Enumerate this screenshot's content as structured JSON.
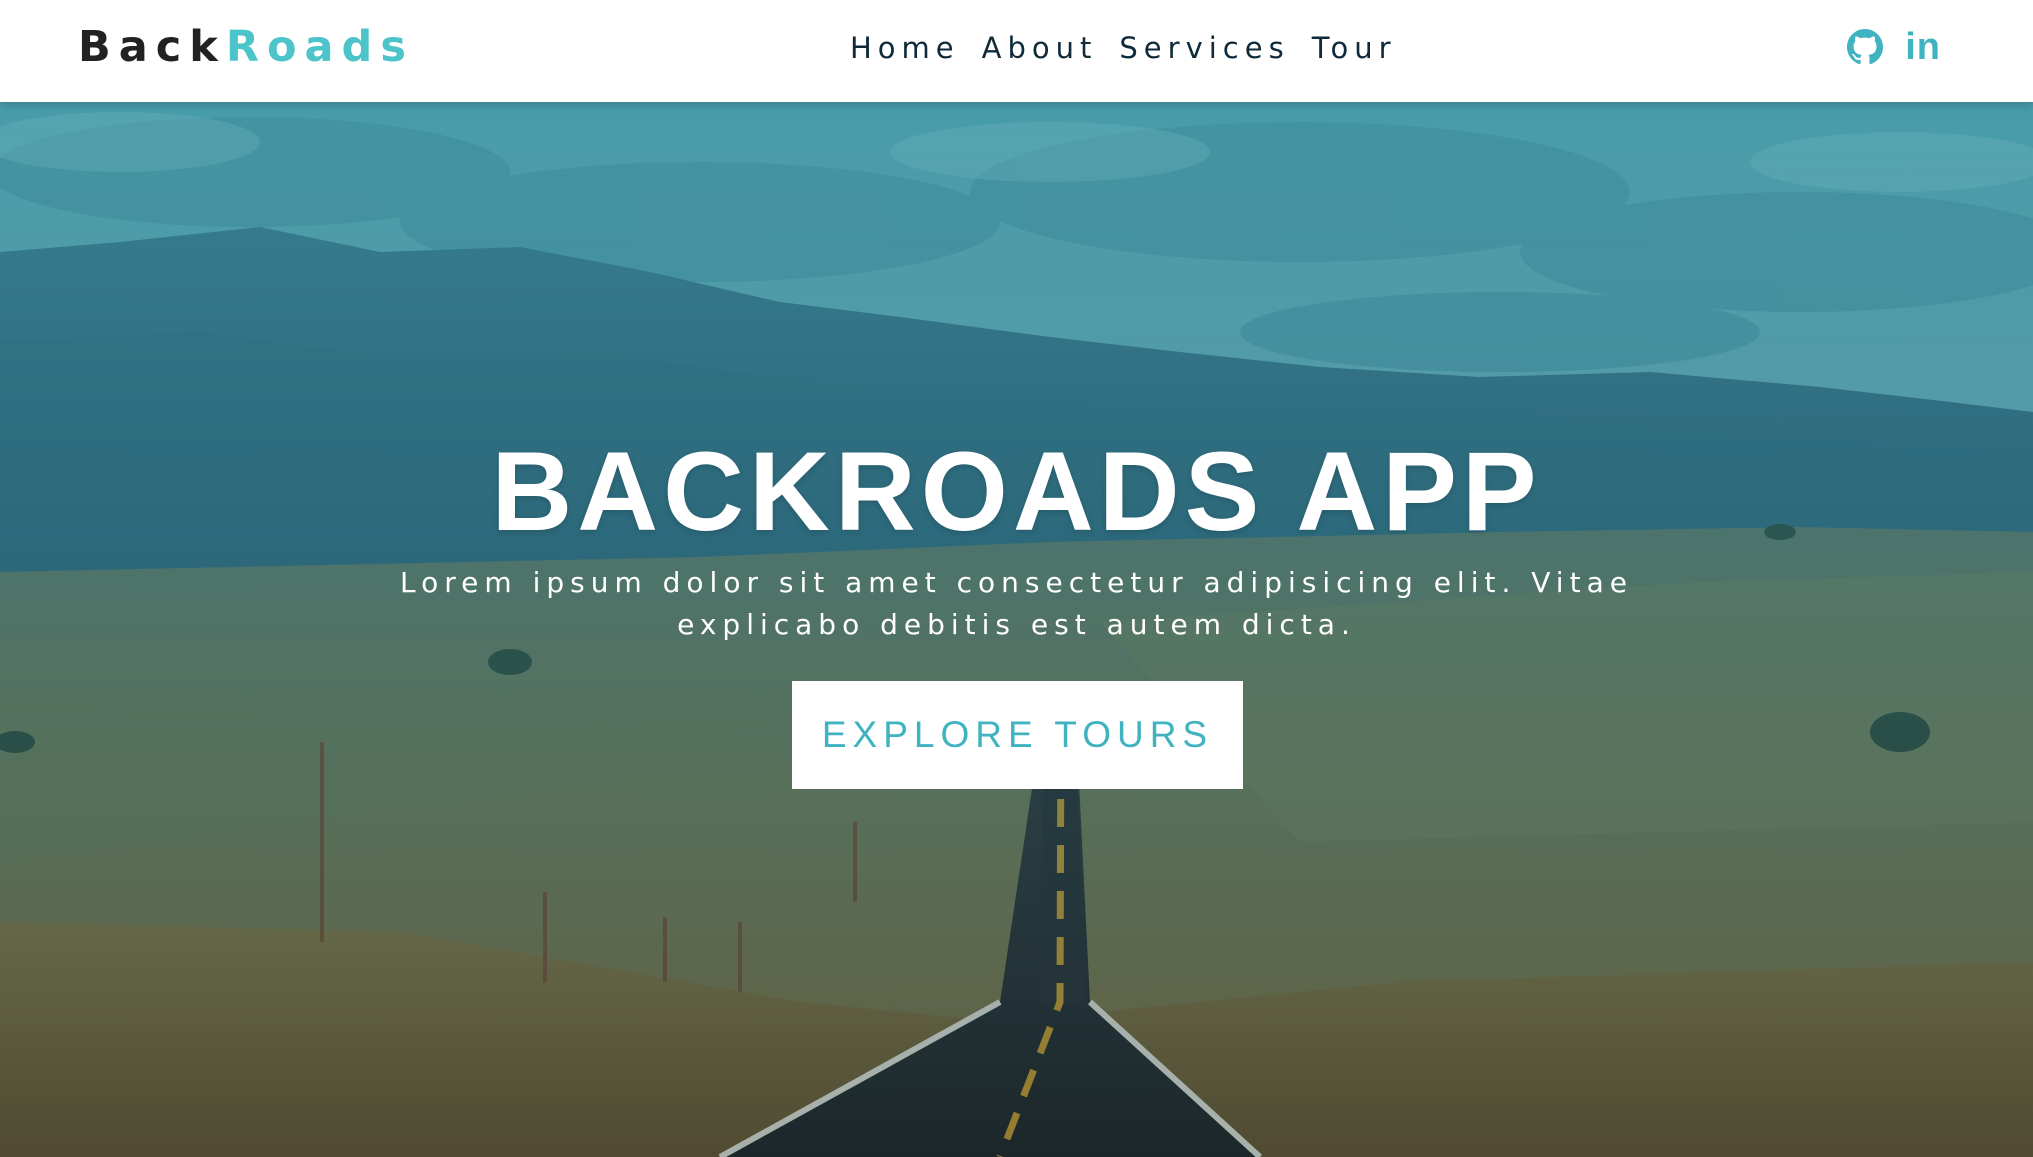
{
  "brand": {
    "part1": "Back",
    "part2": "Roads",
    "dark_color": "#222222",
    "accent_color": "#4cc4c9"
  },
  "nav": {
    "links": [
      "Home",
      "About",
      "Services",
      "Tour"
    ]
  },
  "social": {
    "icons": [
      "github-icon",
      "linkedin-icon"
    ],
    "linkedin_text": "in"
  },
  "hero": {
    "title": "BACKROADS APP",
    "text": "Lorem ipsum dolor sit amet consectetur adipisicing elit. Vitae explicabo debitis est autem dicta.",
    "button_label": "EXPLORE TOURS",
    "button_text_color": "#3fb3c0"
  }
}
